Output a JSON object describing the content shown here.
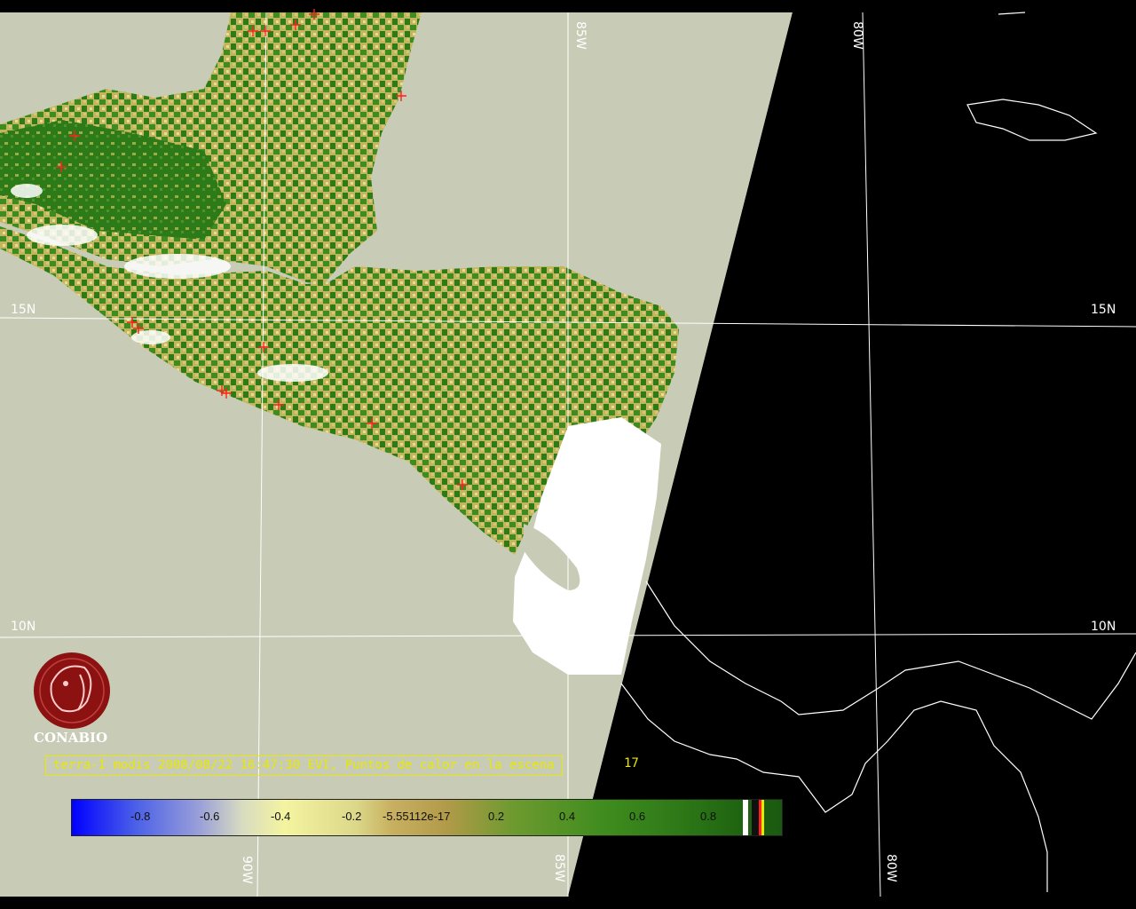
{
  "map": {
    "graticule": {
      "lat_labels_left": [
        "15N",
        "10N"
      ],
      "lat_labels_right": [
        "15N",
        "10N"
      ],
      "lon_labels_top": [
        "85W",
        "80W"
      ],
      "lon_labels_bottom": [
        "90W",
        "85W",
        "80W"
      ]
    },
    "logo": {
      "name": "CONABIO",
      "icon": "conabio-logo-icon"
    },
    "caption": {
      "text": "terra-1 modis 2008/08/22 16:47:30 EVI, Puntos de calor en la escena",
      "count": "17"
    },
    "colorbar": {
      "ticks": [
        "-0.8",
        "-0.6",
        "-0.4",
        "-0.2",
        "-5.55112e-17",
        "0.2",
        "0.4",
        "0.6",
        "0.8"
      ]
    },
    "colors": {
      "ocean_day": "#c8ccb6",
      "night": "#000000",
      "vegetation_dark": "#2e7a1a",
      "vegetation_light": "#d9cf7a",
      "cloud": "#ffffff",
      "hotspot": "#ff2020",
      "caption": "#e8e800"
    }
  }
}
